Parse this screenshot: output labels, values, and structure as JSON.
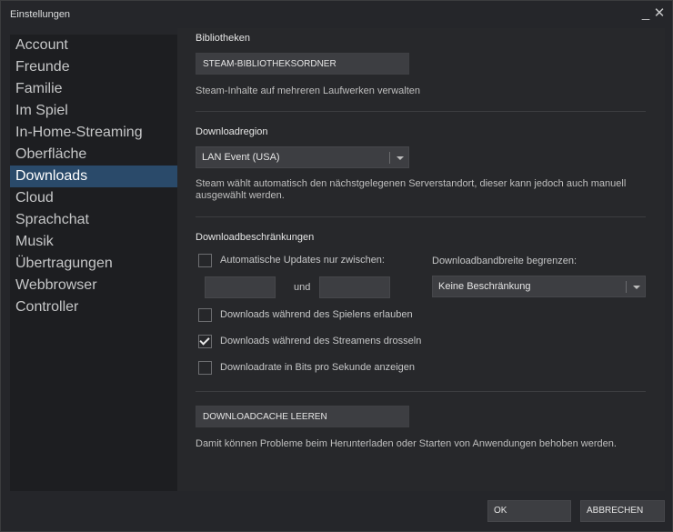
{
  "window": {
    "title": "Einstellungen",
    "minimize_label": "_",
    "close_label": "✕"
  },
  "sidebar": {
    "items": [
      {
        "label": "Account"
      },
      {
        "label": "Freunde"
      },
      {
        "label": "Familie"
      },
      {
        "label": "Im Spiel"
      },
      {
        "label": "In-Home-Streaming"
      },
      {
        "label": "Oberfläche"
      },
      {
        "label": "Downloads",
        "active": true
      },
      {
        "label": "Cloud"
      },
      {
        "label": "Sprachchat"
      },
      {
        "label": "Musik"
      },
      {
        "label": "Übertragungen"
      },
      {
        "label": "Webbrowser"
      },
      {
        "label": "Controller"
      }
    ]
  },
  "libraries": {
    "heading": "Bibliotheken",
    "button_label": "STEAM-BIBLIOTHEKSORDNER",
    "description": "Steam-Inhalte auf mehreren Laufwerken verwalten"
  },
  "region": {
    "heading": "Downloadregion",
    "selected": "LAN Event (USA)",
    "description": "Steam wählt automatisch den nächstgelegenen Serverstandort, dieser kann jedoch auch manuell ausgewählt werden."
  },
  "restrictions": {
    "heading": "Downloadbeschränkungen",
    "auto_updates_label": "Automatische Updates nur zwischen:",
    "auto_updates_checked": false,
    "and_label": "und",
    "time_from": "",
    "time_to": "",
    "bandwidth_label": "Downloadbandbreite begrenzen:",
    "bandwidth_selected": "Keine Beschränkung",
    "allow_while_playing_label": "Downloads während des Spielens erlauben",
    "allow_while_playing_checked": false,
    "throttle_streaming_label": "Downloads während des Streamens drosseln",
    "throttle_streaming_checked": true,
    "show_bits_label": "Downloadrate in Bits pro Sekunde anzeigen",
    "show_bits_checked": false
  },
  "cache": {
    "button_label": "DOWNLOADCACHE LEEREN",
    "description": "Damit können Probleme beim Herunterladen oder Starten von Anwendungen behoben werden."
  },
  "footer": {
    "ok_label": "OK",
    "cancel_label": "ABBRECHEN"
  }
}
